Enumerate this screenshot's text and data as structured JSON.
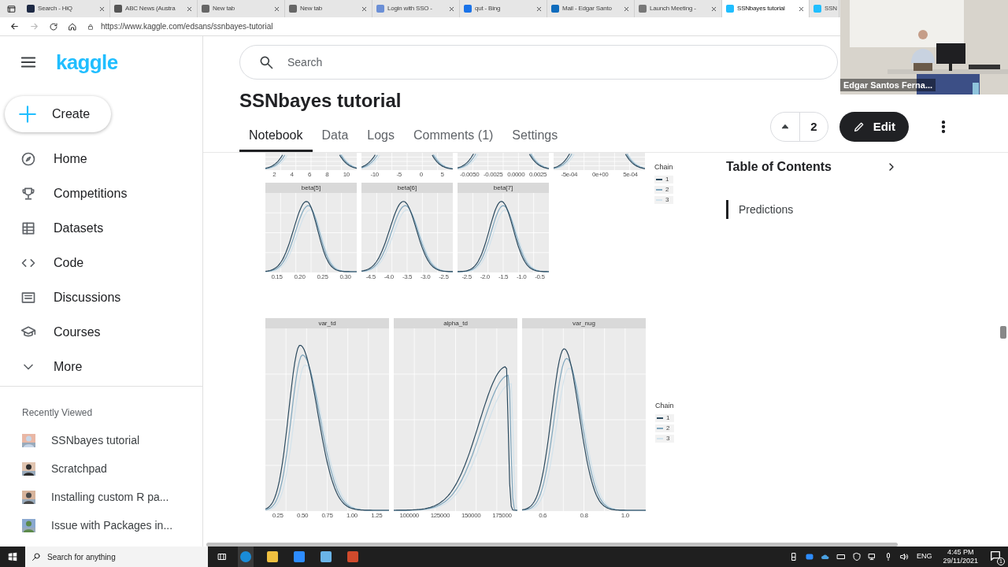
{
  "browser": {
    "tabs": [
      {
        "label": "Search - HiQ",
        "selected": false
      },
      {
        "label": "ABC News (Austra",
        "selected": false
      },
      {
        "label": "New tab",
        "selected": false
      },
      {
        "label": "New tab",
        "selected": false
      },
      {
        "label": "Login with SSO - ",
        "selected": false
      },
      {
        "label": "qut - Bing",
        "selected": false
      },
      {
        "label": "Mail - Edgar Santo",
        "selected": false
      },
      {
        "label": "Launch Meeting -",
        "selected": false
      },
      {
        "label": "SSNbayes tutorial",
        "selected": true
      },
      {
        "label": "SSN",
        "selected": false
      }
    ],
    "url": "https://www.kaggle.com/edsans/ssnbayes-tutorial"
  },
  "sidebar": {
    "logo": "kaggle",
    "create": "Create",
    "items": [
      "Home",
      "Competitions",
      "Datasets",
      "Code",
      "Discussions",
      "Courses",
      "More"
    ],
    "recent_title": "Recently Viewed",
    "recent": [
      "SSNbayes tutorial",
      "Scratchpad",
      "Installing custom R pa...",
      "Issue with Packages in..."
    ]
  },
  "search": {
    "placeholder": "Search"
  },
  "notebook": {
    "title": "SSNbayes tutorial",
    "tabs": [
      {
        "label": "Notebook",
        "selected": true
      },
      {
        "label": "Data",
        "selected": false
      },
      {
        "label": "Logs",
        "selected": false
      },
      {
        "label": "Comments (1)",
        "selected": false
      },
      {
        "label": "Settings",
        "selected": false
      }
    ],
    "votes": "2",
    "edit": "Edit"
  },
  "figures": [
    {
      "legend": {
        "title": "Chain",
        "items": [
          {
            "label": "1",
            "color": "#2c4a5e"
          },
          {
            "label": "2",
            "color": "#7fa6bd"
          },
          {
            "label": "3",
            "color": "#d3e3ec"
          }
        ]
      },
      "rows": [
        {
          "panels": [
            {
              "ticks": [
                "2",
                "4",
                "6",
                "8",
                "10"
              ]
            },
            {
              "ticks": [
                "-10",
                "-5",
                "0",
                "5"
              ]
            },
            {
              "ticks": [
                "-0.0050",
                "-0.0025",
                "0.0000",
                "0.0025"
              ]
            },
            {
              "ticks": [
                "-5e-04",
                "0e+00",
                "5e-04"
              ]
            }
          ]
        },
        {
          "panels": [
            {
              "title": "beta[5]",
              "ticks": [
                "0.15",
                "0.20",
                "0.25",
                "0.30"
              ]
            },
            {
              "title": "beta[6]",
              "ticks": [
                "-4.5",
                "-4.0",
                "-3.5",
                "-3.0",
                "-2.5"
              ]
            },
            {
              "title": "beta[7]",
              "ticks": [
                "-2.5",
                "-2.0",
                "-1.5",
                "-1.0",
                "-0.5"
              ]
            }
          ]
        }
      ]
    },
    {
      "legend": {
        "title": "Chain",
        "items": [
          {
            "label": "1",
            "color": "#2c4a5e"
          },
          {
            "label": "2",
            "color": "#7fa6bd"
          },
          {
            "label": "3",
            "color": "#d3e3ec"
          }
        ]
      },
      "rows": [
        {
          "panels": [
            {
              "title": "var_td",
              "ticks": [
                "0.25",
                "0.50",
                "0.75",
                "1.00",
                "1.25"
              ]
            },
            {
              "title": "alpha_td",
              "ticks": [
                "100000",
                "125000",
                "150000",
                "175000"
              ]
            },
            {
              "title": "var_nug",
              "ticks": [
                "0.6",
                "0.8",
                "1.0"
              ]
            }
          ]
        }
      ]
    }
  ],
  "toc": {
    "title": "Table of Contents",
    "items": [
      "Predictions"
    ]
  },
  "video": {
    "caption": "Edgar Santos Ferna..."
  },
  "taskbar": {
    "search": "Search for anything",
    "language": "ENG",
    "time": "4:45 PM",
    "date": "29/11/2021",
    "notifications": "1"
  }
}
